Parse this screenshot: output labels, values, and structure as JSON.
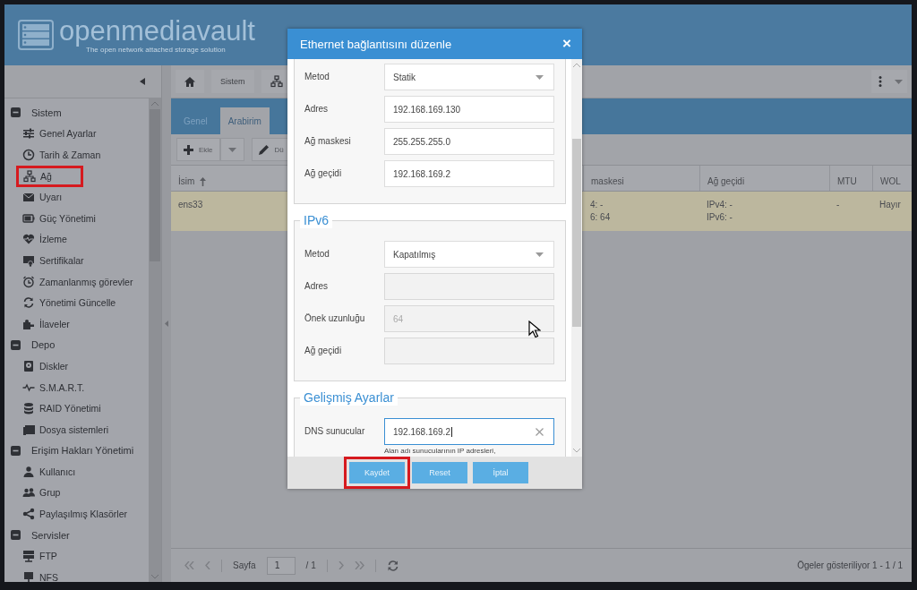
{
  "header": {
    "logo": "openmediavault",
    "tagline": "The open network attached storage solution"
  },
  "breadcrumb": [
    {
      "label": "Sistem"
    }
  ],
  "sidebar": {
    "groups": [
      {
        "label": "Sistem",
        "expanded": true,
        "items": [
          {
            "label": "Genel Ayarlar",
            "highlighted": false
          },
          {
            "label": "Tarih & Zaman",
            "highlighted": false
          },
          {
            "label": "Ağ",
            "highlighted": true
          },
          {
            "label": "Uyarı",
            "highlighted": false
          },
          {
            "label": "Güç Yönetimi",
            "highlighted": false
          },
          {
            "label": "İzleme",
            "highlighted": false
          },
          {
            "label": "Sertifikalar",
            "highlighted": false
          },
          {
            "label": "Zamanlanmış görevler",
            "highlighted": false
          },
          {
            "label": "Yönetimi Güncelle",
            "highlighted": false
          },
          {
            "label": "İlaveler",
            "highlighted": false
          }
        ]
      },
      {
        "label": "Depo",
        "expanded": true,
        "items": [
          {
            "label": "Diskler",
            "highlighted": false
          },
          {
            "label": "S.M.A.R.T.",
            "highlighted": false
          },
          {
            "label": "RAID Yönetimi",
            "highlighted": false
          },
          {
            "label": "Dosya sistemleri",
            "highlighted": false
          }
        ]
      },
      {
        "label": "Erişim Hakları Yönetimi",
        "expanded": true,
        "items": [
          {
            "label": "Kullanıcı",
            "highlighted": false
          },
          {
            "label": "Grup",
            "highlighted": false
          },
          {
            "label": "Paylaşılmış Klasörler",
            "highlighted": false
          }
        ]
      },
      {
        "label": "Servisler",
        "expanded": true,
        "items": [
          {
            "label": "FTP",
            "highlighted": false
          },
          {
            "label": "NFS",
            "highlighted": false
          }
        ]
      }
    ]
  },
  "tabs": [
    {
      "label": "Genel",
      "selected": false
    },
    {
      "label": "Arabirim",
      "selected": true
    }
  ],
  "toolbar": [
    {
      "label": "Ekle",
      "kind": "add"
    },
    {
      "label": "Dü",
      "kind": "edit"
    }
  ],
  "table": {
    "columns": [
      {
        "label": "İsim",
        "sorted": true
      },
      {
        "label": "maskesi",
        "sorted": false
      },
      {
        "label": "Ağ geçidi",
        "sorted": false
      },
      {
        "label": "MTU",
        "sorted": false
      },
      {
        "label": "WOL",
        "sorted": false
      }
    ],
    "rows": [
      {
        "selected": true,
        "cells": [
          [
            "ens33"
          ],
          [
            "4: -",
            "6: 64"
          ],
          [
            "IPv4: -",
            "IPv6: -"
          ],
          [
            "-"
          ],
          [
            "Hayır"
          ]
        ]
      }
    ]
  },
  "pager": {
    "page_label": "Sayfa",
    "page": "1",
    "of": "/ 1",
    "summary": "Ögeler gösteriliyor 1 - 1 / 1"
  },
  "dialog": {
    "title": "Ethernet bağlantısını düzenle",
    "close": "×",
    "sections": [
      {
        "fields": [
          {
            "label": "Metod",
            "kind": "select",
            "value": "Statik",
            "disabled": false
          },
          {
            "label": "Adres",
            "kind": "text",
            "value": "192.168.169.130",
            "disabled": false
          },
          {
            "label": "Ağ maskesi",
            "kind": "text",
            "value": "255.255.255.0",
            "disabled": false
          },
          {
            "label": "Ağ geçidi",
            "kind": "text",
            "value": "192.168.169.2",
            "disabled": false
          }
        ]
      },
      {
        "legend": "IPv6",
        "fields": [
          {
            "label": "Metod",
            "kind": "select",
            "value": "Kapatılmış",
            "disabled": false
          },
          {
            "label": "Adres",
            "kind": "text",
            "disabled": true
          },
          {
            "label": "Önek uzunluğu",
            "kind": "text",
            "placeholder": "64",
            "disabled": true
          },
          {
            "label": "Ağ geçidi",
            "kind": "text",
            "disabled": true
          }
        ]
      },
      {
        "legend": "Gelişmiş Ayarlar",
        "fields": [
          {
            "label": "DNS sunucular",
            "kind": "clearable",
            "value": "192.168.169.2",
            "disabled": false,
            "hint": "Alan adı sunucularının IP adresleri,"
          }
        ]
      }
    ],
    "buttons": [
      {
        "label": "Kaydet",
        "highlighted": true
      },
      {
        "label": "Reset",
        "highlighted": false
      },
      {
        "label": "İptal",
        "highlighted": false
      }
    ]
  }
}
